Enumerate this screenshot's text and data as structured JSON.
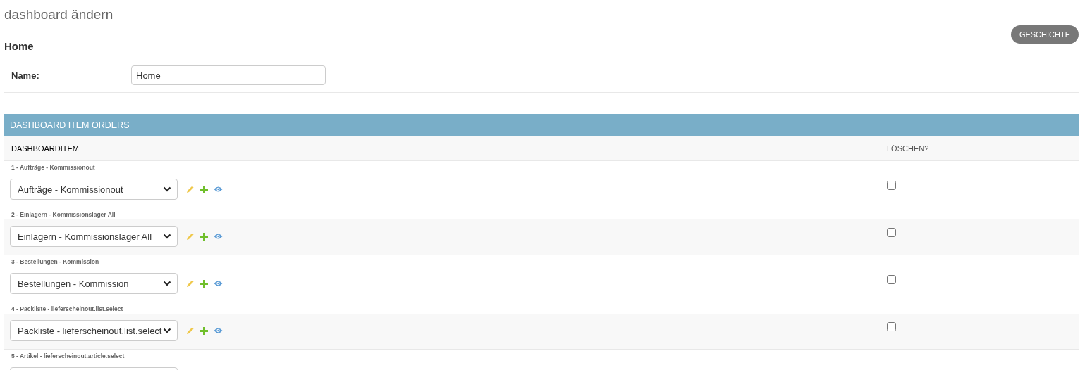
{
  "page_title": "dashboard ändern",
  "history_button": "GESCHICHTE",
  "object_title": "Home",
  "name_field": {
    "label": "Name:",
    "value": "Home"
  },
  "inline": {
    "title": "DASHBOARD ITEM ORDERS",
    "columns": [
      "DASHBOARDITEM",
      "LÖSCHEN?"
    ],
    "rows": [
      {
        "label": "1 - Aufträge - Kommissionout",
        "value": "Aufträge - Kommissionout",
        "delete_checked": false
      },
      {
        "label": "2 - Einlagern - Kommissionslager All",
        "value": "Einlagern - Kommissionslager All",
        "delete_checked": false
      },
      {
        "label": "3 - Bestellungen - Kommission",
        "value": "Bestellungen - Kommission",
        "delete_checked": false
      },
      {
        "label": "4 - Packliste - lieferscheinout.list.select",
        "value": "Packliste - lieferscheinout.list.select",
        "delete_checked": false
      },
      {
        "label": "5 - Artikel - lieferscheinout.article.select"
      }
    ]
  }
}
